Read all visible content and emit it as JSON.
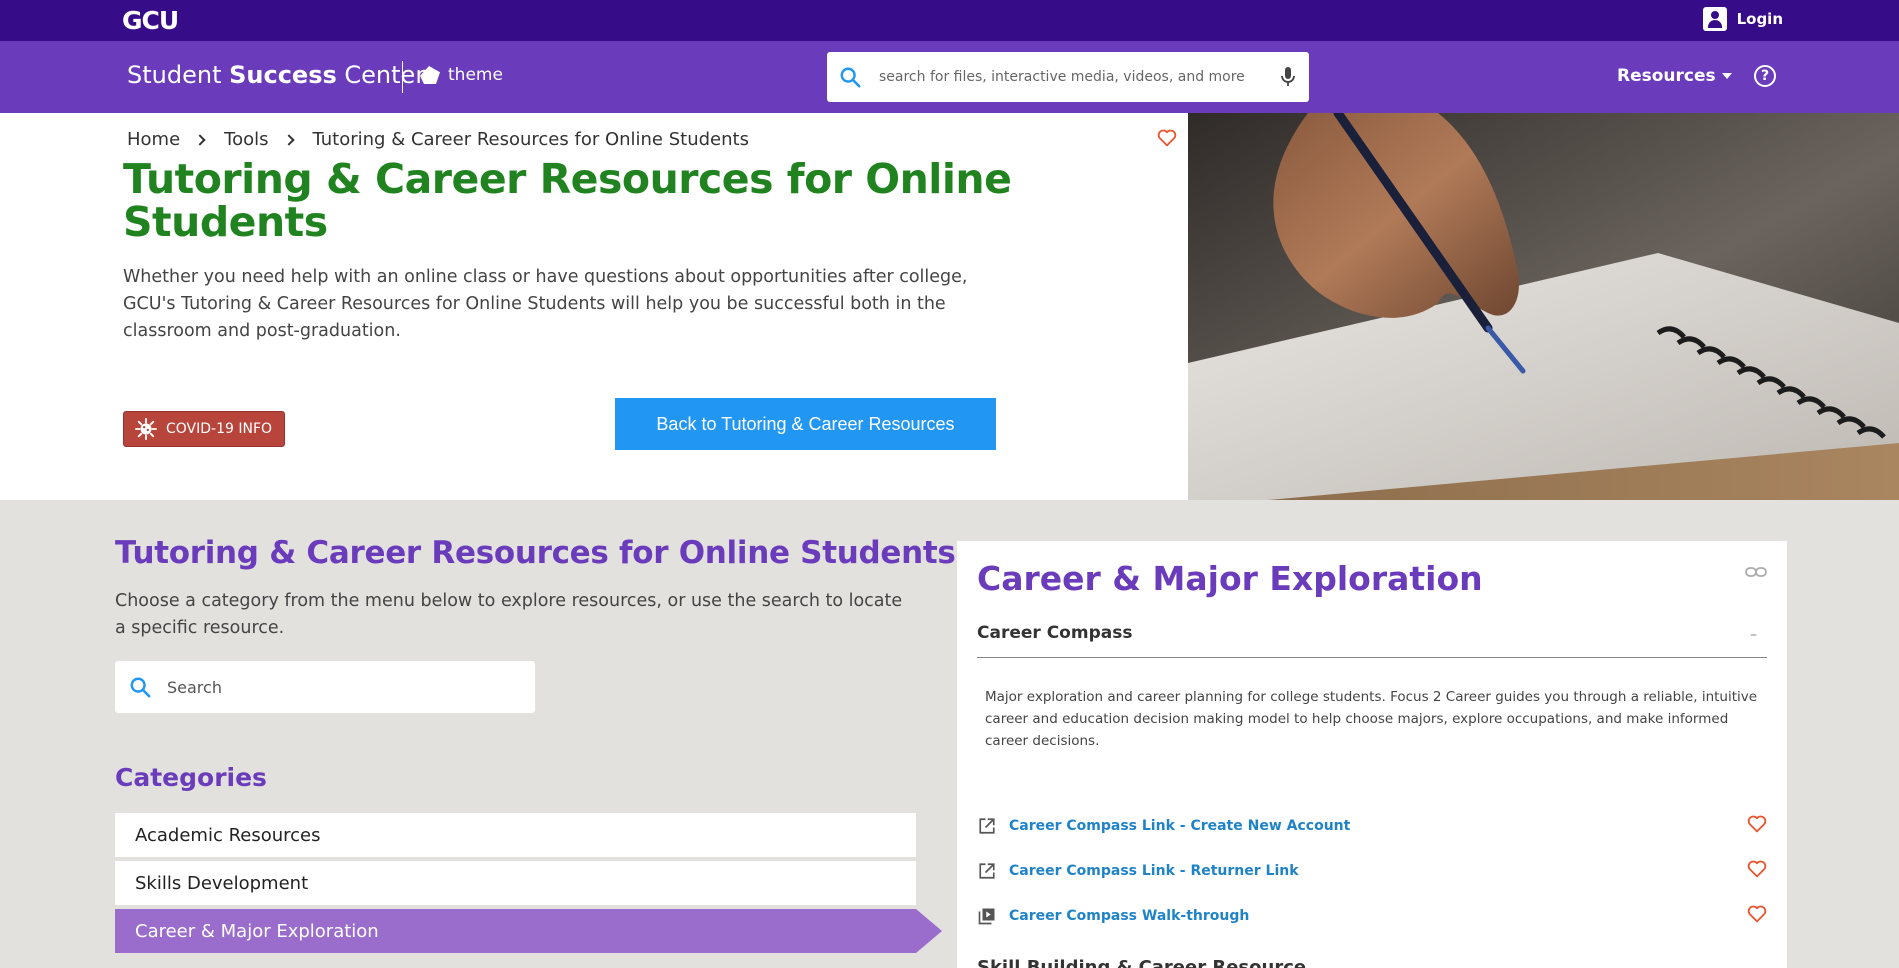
{
  "topbar": {
    "logo": "GCU",
    "login_label": "Login"
  },
  "navbar": {
    "site_title_prefix": "Student ",
    "site_title_bold": "Success",
    "site_title_suffix": " Center",
    "theme_label": "theme",
    "search_placeholder": "search for files, interactive media, videos, and more",
    "resources_label": "Resources"
  },
  "hero": {
    "breadcrumb": [
      "Home",
      "Tools",
      "Tutoring & Career Resources for Online Students"
    ],
    "title": "Tutoring & Career Resources for Online Students",
    "description": "Whether you need help with an online class or have questions about opportunities after college, GCU's Tutoring & Career Resources for Online Students will help you be successful both in the classroom and post-graduation.",
    "covid_label": "COVID-19 INFO",
    "back_button_label": "Back to Tutoring & Career Resources"
  },
  "content": {
    "section_title": "Tutoring & Career Resources for Online Students",
    "section_description": "Choose a category from the menu below to explore resources, or use the search to locate a specific resource.",
    "search_placeholder": "Search",
    "categories_label": "Categories",
    "categories": [
      {
        "label": "Academic Resources",
        "active": false
      },
      {
        "label": "Skills Development",
        "active": false
      },
      {
        "label": "Career & Major Exploration",
        "active": true
      }
    ]
  },
  "detail": {
    "title": "Career & Major Exploration",
    "resource_name": "Career Compass",
    "collapse_indicator": "–",
    "resource_description": "Major exploration and career planning for college students. Focus 2 Career guides you through a reliable, intuitive career and education decision making model to help choose majors, explore occupations, and make informed career decisions.",
    "links": [
      {
        "label": "Career Compass Link - Create New Account",
        "icon": "external-link-icon"
      },
      {
        "label": "Career Compass Link - Returner Link",
        "icon": "external-link-icon"
      },
      {
        "label": "Career Compass Walk-through",
        "icon": "video-icon"
      }
    ],
    "next_heading": "Skill Building & Career Resource"
  },
  "colors": {
    "topbar": "#360c88",
    "navbar": "#6a3cbc",
    "hero_title": "#208320",
    "accent_purple": "#6a3cbc",
    "active_category": "#9a6ccb",
    "button_blue": "#2196f3",
    "covid_red": "#b8453c",
    "link_blue": "#1f83c8",
    "heart": "#e8552f"
  }
}
